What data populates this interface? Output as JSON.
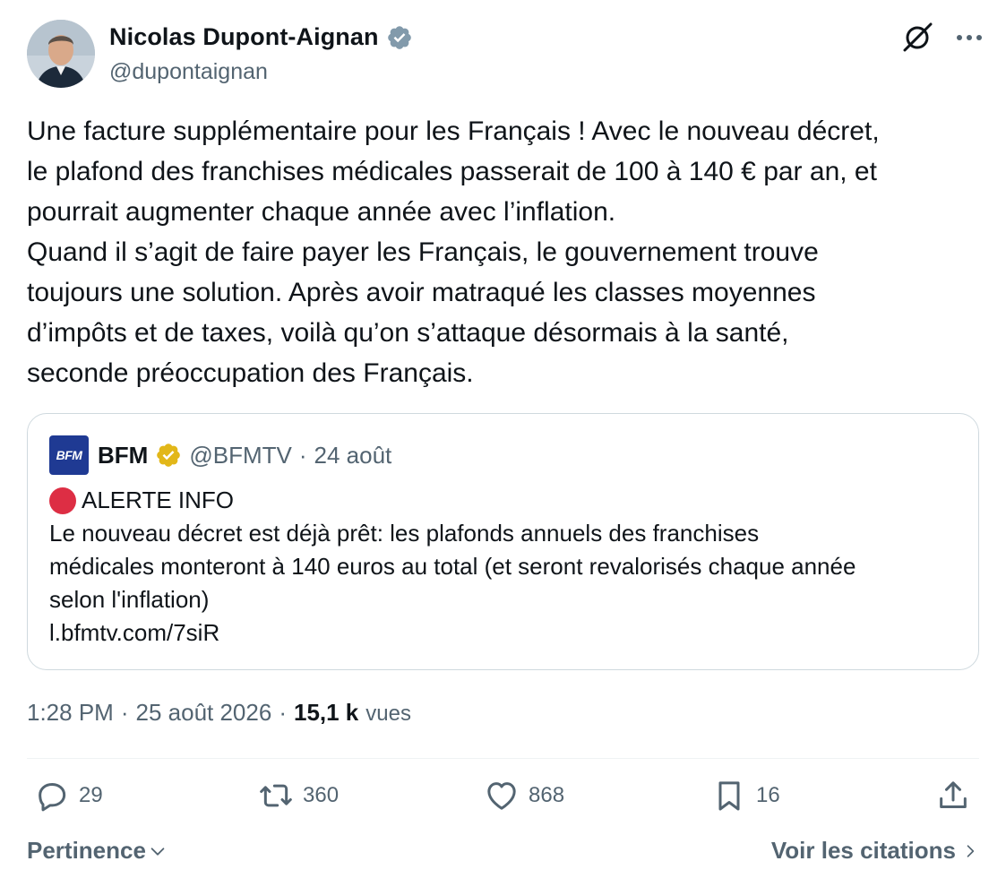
{
  "author": {
    "name": "Nicolas Dupont-Aignan",
    "handle": "@dupontaignan",
    "verified_badge_color": "#829aab"
  },
  "header_icons": [
    "grok-icon",
    "more-icon"
  ],
  "tweet": {
    "lines": [
      "Une facture supplémentaire pour les Français ! Avec le nouveau décret,",
      "le plafond des franchises médicales passerait de 100 à 140 € par an, et",
      "pourrait augmenter chaque année avec l’inflation.",
      "Quand il s’agit de faire payer les Français, le gouvernement trouve",
      "toujours une solution. Après avoir matraqué les classes moyennes",
      "d’impôts et de taxes, voilà qu’on s’attaque désormais à la santé,",
      "seconde préoccupation des Français."
    ]
  },
  "quote": {
    "logo_text": "BFM",
    "name": "BFM",
    "handle": "@BFMTV",
    "separator": "·",
    "date": "24 août",
    "gold_badge_color": "#e2b719",
    "alert": "ALERTE INFO",
    "lines": [
      "Le nouveau décret est déjà prêt: les plafonds annuels des franchises",
      "médicales monteront à 140 euros au total (et seront revalorisés chaque année",
      "selon l'inflation)",
      "l.bfmtv.com/7siR"
    ]
  },
  "meta": {
    "time": "1:28 PM",
    "sep1": "·",
    "date": "25 août 2026",
    "sep2": "·",
    "views_count": "15,1 k",
    "views_label": "vues"
  },
  "actions": {
    "replies": "29",
    "reposts": "360",
    "likes": "868",
    "bookmarks": "16"
  },
  "footer": {
    "sort_label": "Pertinence",
    "quotes_link": "Voir les citations"
  },
  "colors": {
    "text": "#0f1419",
    "secondary": "#536471",
    "border": "#cfd9de",
    "alert_red": "#dd2e44",
    "bfm_blue": "#1f3a93"
  }
}
